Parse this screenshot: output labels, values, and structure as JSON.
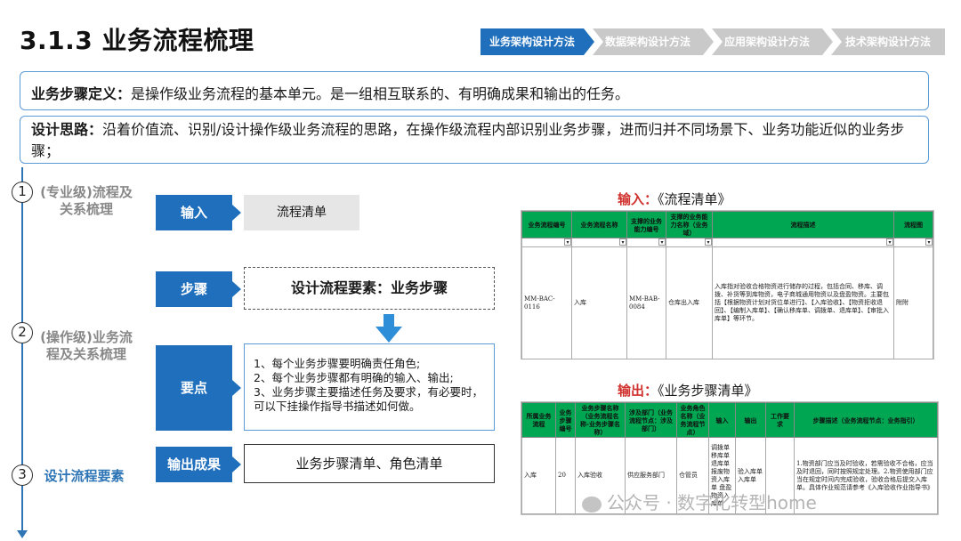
{
  "page_title": "3.1.3 业务流程梳理",
  "nav_steps": [
    {
      "label": "业务架构设计方法",
      "active": true
    },
    {
      "label": "数据架构设计方法",
      "active": false
    },
    {
      "label": "应用架构设计方法",
      "active": false
    },
    {
      "label": "技术架构设计方法",
      "active": false
    }
  ],
  "definition": {
    "label": "业务步骤定义：",
    "text": "是操作级业务流程的基本单元。是一组相互联系的、有明确成果和输出的任务。"
  },
  "approach": {
    "label": "设计思路：",
    "text": "沿着价值流、识别/设计操作级业务流程的思路，在操作级流程内部识别业务步骤，进而归并不同场景下、业务功能近似的业务步骤；"
  },
  "phases": [
    {
      "num": "1",
      "label": "(专业级)流程及关系梳理"
    },
    {
      "num": "2",
      "label": "(操作级)业务流程及关系梳理"
    },
    {
      "num": "3",
      "label": "设计流程要素"
    }
  ],
  "flow": {
    "input_label": "输入",
    "input_value": "流程清单",
    "step_label": "步骤",
    "step_value": "设计流程要素：业务步骤",
    "points_label": "要点",
    "points": [
      "1、每个业务步骤要明确责任角色;",
      "2、每个业务步骤都有明确的输入、输出;",
      "3、业务步骤主要描述任务及要求，有必要时，可以下挂操作指导书描述如何做。"
    ],
    "output_label": "输出成果",
    "output_value": "业务步骤清单、角色清单"
  },
  "input_sheet": {
    "caption_prefix": "输入：",
    "caption_title": "《流程清单》",
    "headers": [
      "业务流程编号",
      "业务流程名称",
      "支撑的业务能力编号",
      "支撑的业务能力名称（业务域）",
      "流程描述",
      "流程图"
    ],
    "row": [
      "MM-BAC-0116",
      "入库",
      "MM-BAB-0084",
      "仓库出入库",
      "入库指对验收合格物资进行储存的过程，包括合同、移库、调拨、补货等到库物资，电子商城通用物资以及盘盈物资。主要包括【根据物资计划对货位单进行】、【入库验收】、【物资拒收退回】、【编制入库单】、【确认移库单、调拨单、退库单】、【审批入库单】等环节。",
      "附附"
    ]
  },
  "output_sheet": {
    "caption_prefix": "输出：",
    "caption_title": "《业务步骤清单》",
    "headers": [
      "所属业务流程",
      "业务步骤编号",
      "业务步骤名称（业务流程名称-业务步骤名称）",
      "涉及部门（业务流程节点：涉及部门）",
      "业务角色名称（业务流程节点）",
      "输入",
      "输出",
      "工作要求",
      "步骤描述（业务流程节点：业务指引）"
    ],
    "row": [
      "入库",
      "20",
      "入库验收",
      "供应服务部门",
      "仓管员",
      "调拨单 移库单 退库单 报废物资入库单 盘盈物资入库单",
      "验入库单 入库单",
      "",
      "1.物资部门应当及时验收，若需验收不合格，应当及时退回，同时按照规定处理。2.物资使用部门应当在规定时间内完成验收，验收合格后提交入库单。具体作业规范请参考《入库验收作业指导书》"
    ]
  },
  "watermark": "公众号 · 数字化转型home"
}
